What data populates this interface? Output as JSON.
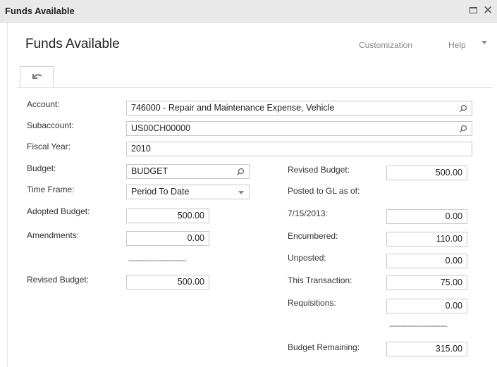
{
  "window": {
    "title": "Funds Available"
  },
  "header": {
    "title": "Funds Available",
    "customization": "Customization",
    "help": "Help"
  },
  "form": {
    "account": {
      "label": "Account:",
      "value": "746000 - Repair and Maintenance Expense, Vehicle"
    },
    "subaccount": {
      "label": "Subaccount:",
      "value": "US00CH00000"
    },
    "fiscal_year": {
      "label": "Fiscal Year:",
      "value": "2010"
    },
    "budget": {
      "label": "Budget:",
      "value": "BUDGET"
    },
    "time_frame": {
      "label": "Time Frame:",
      "value": "Period To Date"
    },
    "adopted_budget": {
      "label": "Adopted Budget:",
      "value": "500.00"
    },
    "amendments": {
      "label": "Amendments:",
      "value": "0.00"
    },
    "left_separator": "--------------------------",
    "revised_budget_left": {
      "label": "Revised Budget:",
      "value": "500.00"
    },
    "revised_budget_right": {
      "label": "Revised Budget:",
      "value": "500.00"
    },
    "posted_to_gl": {
      "label": "Posted to GL as of:"
    },
    "posted_date": {
      "label": "7/15/2013:",
      "value": "0.00"
    },
    "encumbered": {
      "label": "Encumbered:",
      "value": "110.00"
    },
    "unposted": {
      "label": "Unposted:",
      "value": "0.00"
    },
    "this_transaction": {
      "label": "This Transaction:",
      "value": "75.00"
    },
    "requisitions": {
      "label": "Requisitions:",
      "value": "0.00"
    },
    "right_separator": "--------------------------",
    "budget_remaining": {
      "label": "Budget Remaining:",
      "value": "315.00"
    }
  },
  "icons": {
    "maximize": "maximize-icon",
    "close": "close-icon",
    "undo": "undo-icon",
    "search": "search-icon",
    "dropdown": "chevron-down-icon"
  }
}
